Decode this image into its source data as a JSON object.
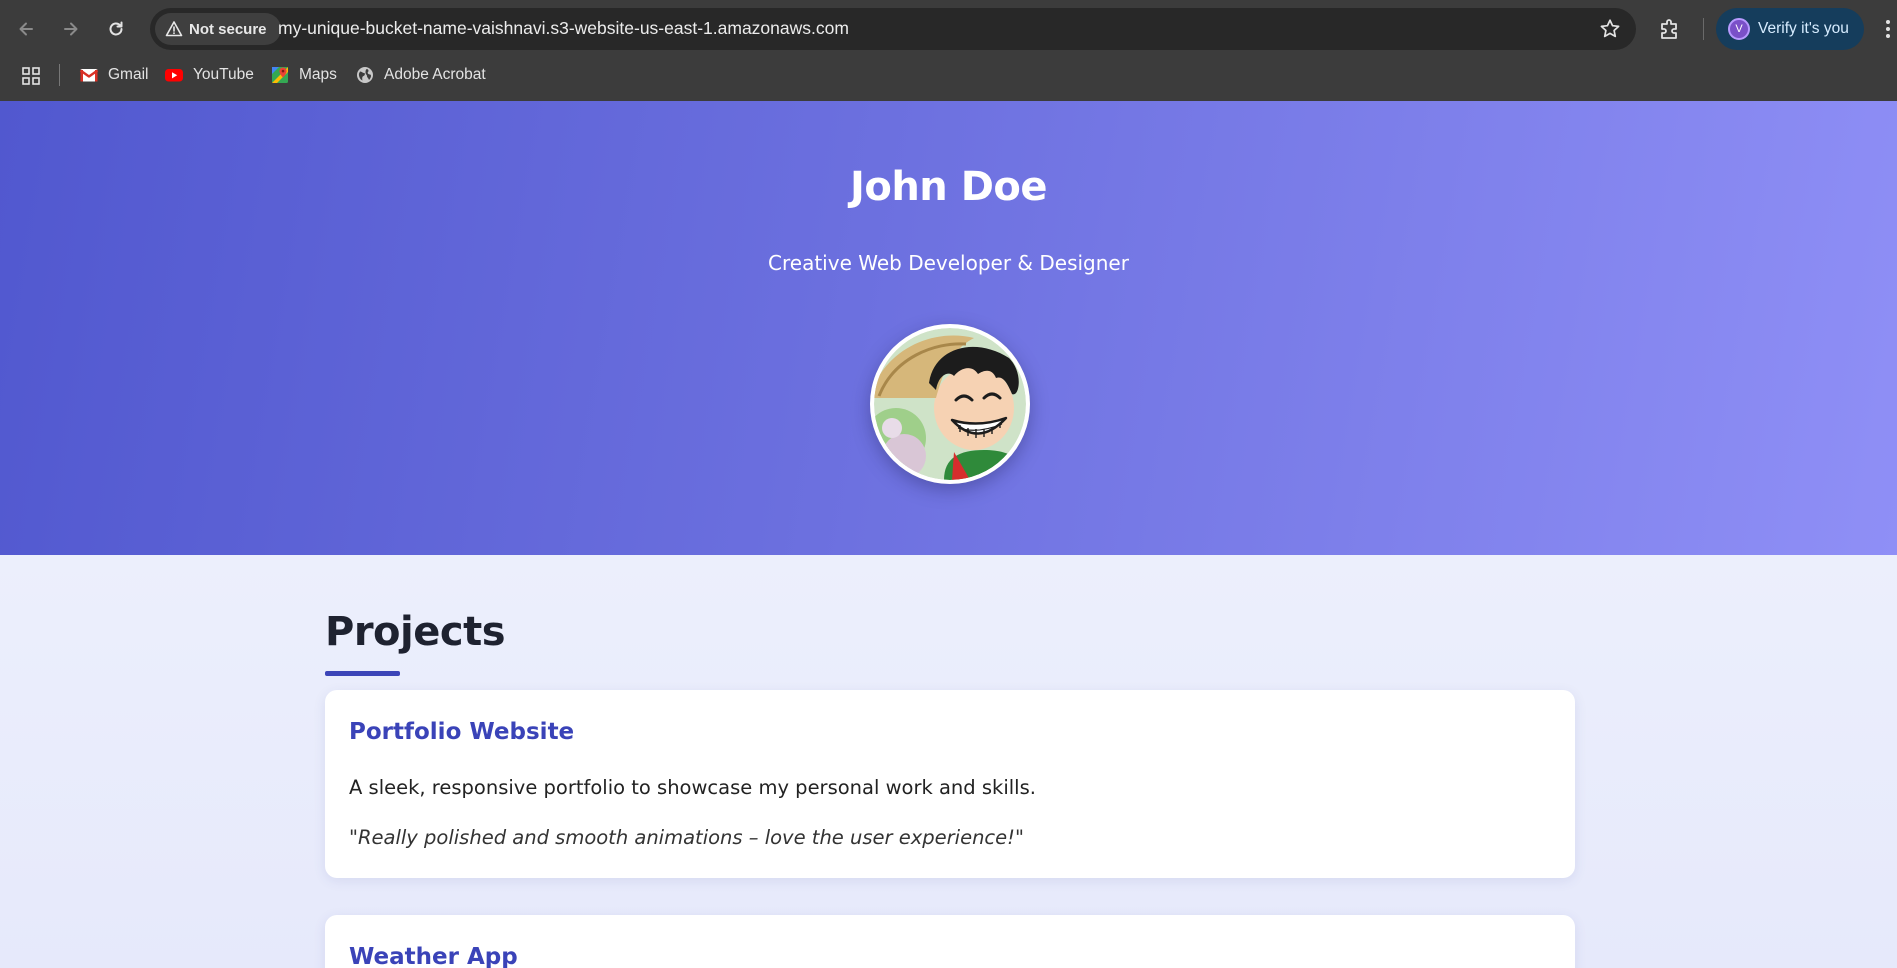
{
  "browser": {
    "security_label": "Not secure",
    "url": "my-unique-bucket-name-vaishnavi.s3-website-us-east-1.amazonaws.com",
    "profile_label": "Verify it's you",
    "profile_initial": "V",
    "icons": [
      "back-icon",
      "forward-icon",
      "reload-icon",
      "warning-icon",
      "star-icon",
      "extensions-icon",
      "menu-icon",
      "apps-icon"
    ]
  },
  "bookmarks": [
    {
      "label": "Gmail",
      "icon": "gmail-icon"
    },
    {
      "label": "YouTube",
      "icon": "youtube-icon"
    },
    {
      "label": "Maps",
      "icon": "maps-icon"
    },
    {
      "label": "Adobe Acrobat",
      "icon": "globe-icon"
    }
  ],
  "hero": {
    "name": "John Doe",
    "tagline": "Creative Web Developer & Designer"
  },
  "projects": {
    "heading": "Projects",
    "items": [
      {
        "title": "Portfolio Website",
        "description": "A sleek, responsive portfolio to showcase my personal work and skills.",
        "quote": "\"Really polished and smooth animations – love the user experience!\""
      },
      {
        "title": "Weather App"
      }
    ]
  },
  "colors": {
    "chrome_bg": "#3c3c3c",
    "hero_gradient_start": "#5158cf",
    "hero_gradient_end": "#8f8ff6",
    "accent": "#3a43b8",
    "page_bg": "#eceffc"
  }
}
